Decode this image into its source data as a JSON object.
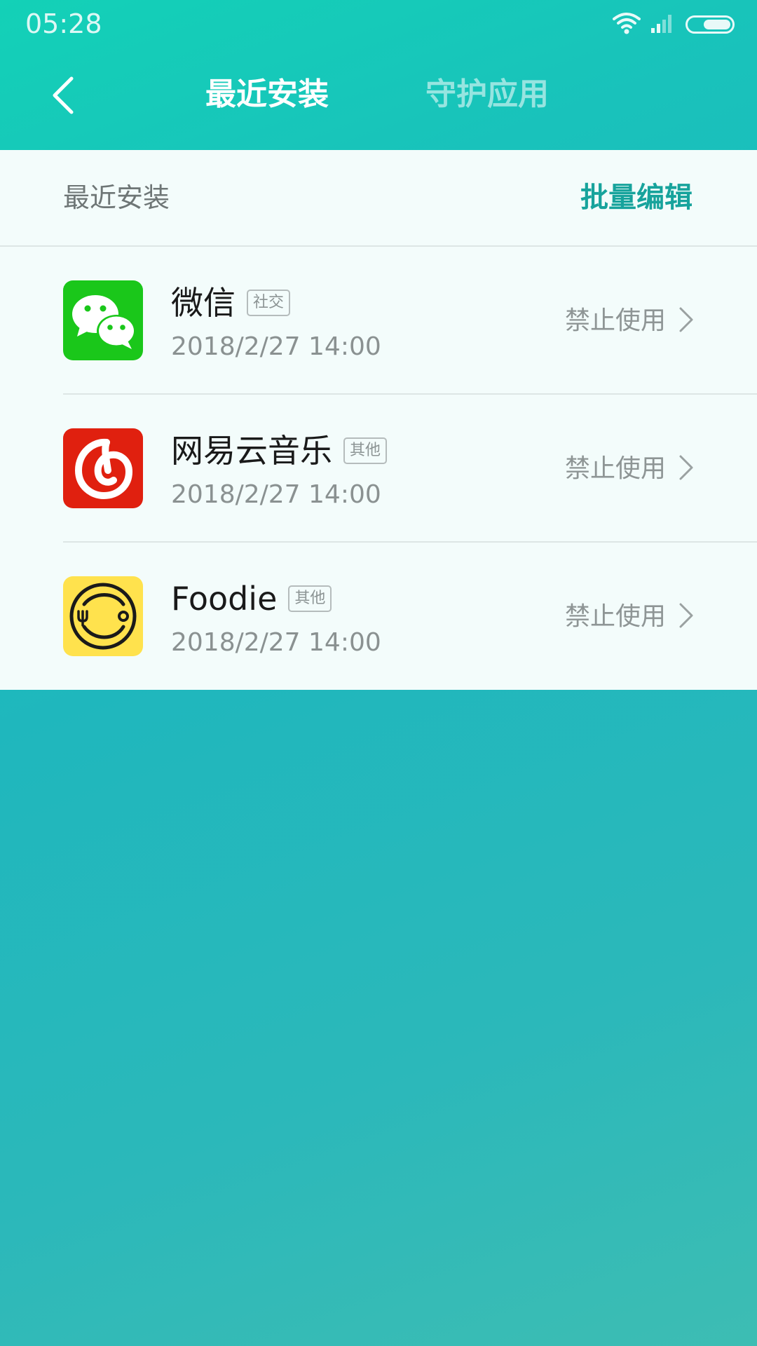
{
  "status_bar": {
    "time": "05:28",
    "icons": [
      "wifi-icon",
      "cellular-signal-icon",
      "battery-icon"
    ]
  },
  "header": {
    "tabs": [
      {
        "label": "最近安装",
        "active": true
      },
      {
        "label": "守护应用",
        "active": false
      }
    ],
    "back_icon": "chevron-left-icon"
  },
  "section": {
    "title": "最近安装",
    "batch_edit_label": "批量编辑"
  },
  "apps": [
    {
      "name": "微信",
      "tag": "社交",
      "date": "2018/2/27 14:00",
      "action": "禁止使用",
      "icon": "wechat-icon",
      "icon_color": "#1ac71a"
    },
    {
      "name": "网易云音乐",
      "tag": "其他",
      "date": "2018/2/27 14:00",
      "action": "禁止使用",
      "icon": "netease-music-icon",
      "icon_color": "#e0200f"
    },
    {
      "name": "Foodie",
      "tag": "其他",
      "date": "2018/2/27 14:00",
      "action": "禁止使用",
      "icon": "foodie-icon",
      "icon_color": "#ffe24d"
    }
  ],
  "colors": {
    "accent": "#17a39c",
    "header_gradient_start": "#13d1b7",
    "background_end": "#3dbdb3",
    "card_background": "#f3fcfb"
  }
}
